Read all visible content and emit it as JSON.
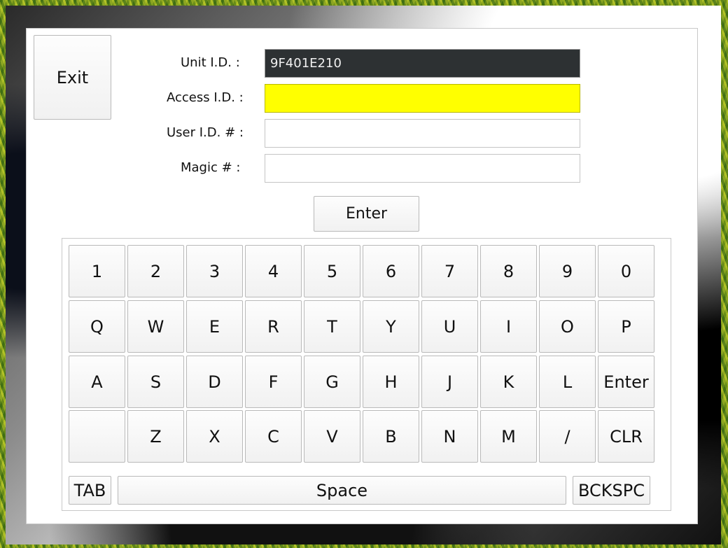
{
  "window": {
    "exit_label": "Exit"
  },
  "form": {
    "unit_id_label": "Unit I.D. :",
    "unit_id_value": "9F401E210",
    "access_id_label": "Access I.D. :",
    "access_id_value": "",
    "user_id_label": "User I.D. # :",
    "user_id_value": "",
    "magic_label": "Magic # :",
    "magic_value": "",
    "enter_label": "Enter",
    "colors": {
      "unit_field_bg": "#2d3133",
      "access_field_bg": "#ffff00"
    }
  },
  "keyboard": {
    "rows": [
      [
        "1",
        "2",
        "3",
        "4",
        "5",
        "6",
        "7",
        "8",
        "9",
        "0"
      ],
      [
        "Q",
        "W",
        "E",
        "R",
        "T",
        "Y",
        "U",
        "I",
        "O",
        "P"
      ],
      [
        "A",
        "S",
        "D",
        "F",
        "G",
        "H",
        "J",
        "K",
        "L",
        "Enter"
      ],
      [
        "",
        "Z",
        "X",
        "C",
        "V",
        "B",
        "N",
        "M",
        "/",
        "CLR"
      ]
    ],
    "tab_label": "TAB",
    "space_label": "Space",
    "backspace_label": "BCKSPC"
  }
}
